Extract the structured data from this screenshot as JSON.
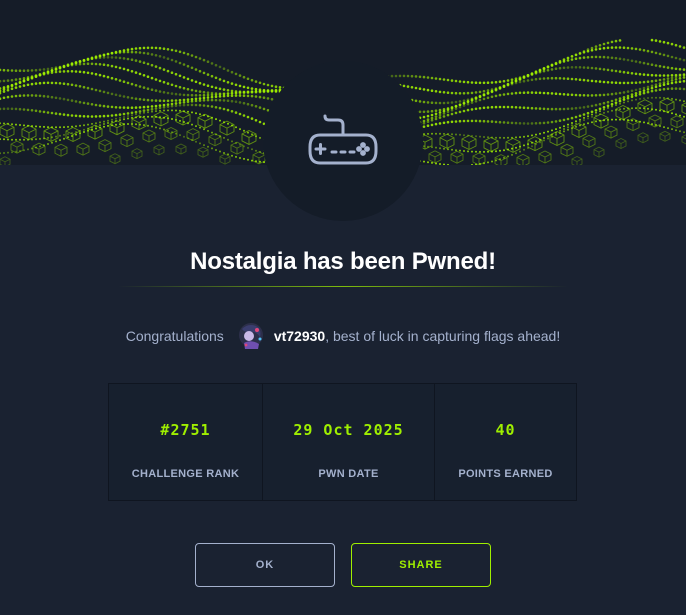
{
  "modal": {
    "title": "Nostalgia has been Pwned!",
    "congrats_prefix": "Congratulations",
    "username": "vt72930",
    "congrats_suffix": ", best of luck in capturing flags ahead!",
    "badge_icon": "gamepad-icon"
  },
  "stats": [
    {
      "value": "#2751",
      "label": "CHALLENGE RANK"
    },
    {
      "value": "29 Oct 2025",
      "label": "PWN DATE"
    },
    {
      "value": "40",
      "label": "POINTS EARNED"
    }
  ],
  "buttons": {
    "ok_label": "OK",
    "share_label": "SHARE"
  },
  "colors": {
    "accent": "#9fef00",
    "background": "#1a2231",
    "text_muted": "#a4b1cd"
  }
}
